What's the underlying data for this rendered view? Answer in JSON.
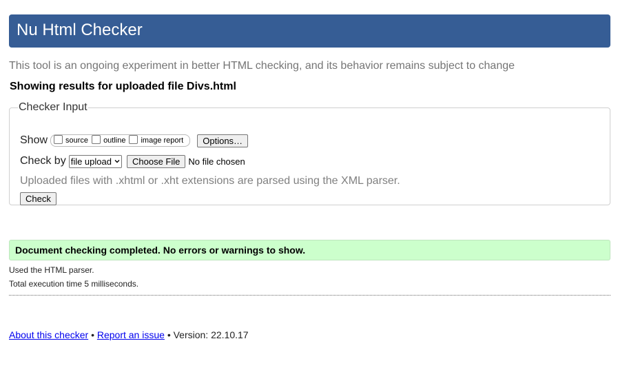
{
  "header": {
    "title": "Nu Html Checker"
  },
  "intro_text": "This tool is an ongoing experiment in better HTML checking, and its behavior remains subject to change",
  "results_heading": "Showing results for uploaded file Divs.html",
  "checker_input": {
    "legend": "Checker Input",
    "show_label": "Show",
    "show_options": [
      {
        "label": "source",
        "checked": false
      },
      {
        "label": "outline",
        "checked": false
      },
      {
        "label": "image report",
        "checked": false
      }
    ],
    "options_button": "Options…",
    "check_by_label": "Check by",
    "check_by_value": "file upload",
    "choose_file_button": "Choose File",
    "no_file_text": "No file chosen",
    "note": "Uploaded files with .xhtml or .xht extensions are parsed using the XML parser.",
    "check_button": "Check"
  },
  "result": {
    "message": "Document checking completed. No errors or warnings to show.",
    "parser_line": "Used the HTML parser.",
    "time_line": "Total execution time 5 milliseconds."
  },
  "footer": {
    "about_link": "About this checker",
    "separator": "•",
    "report_link": "Report an issue",
    "version_text": "Version: 22.10.17"
  },
  "colors": {
    "header_bg": "#365d95",
    "success_bg": "#ccffcc",
    "link": "#0000ee"
  }
}
